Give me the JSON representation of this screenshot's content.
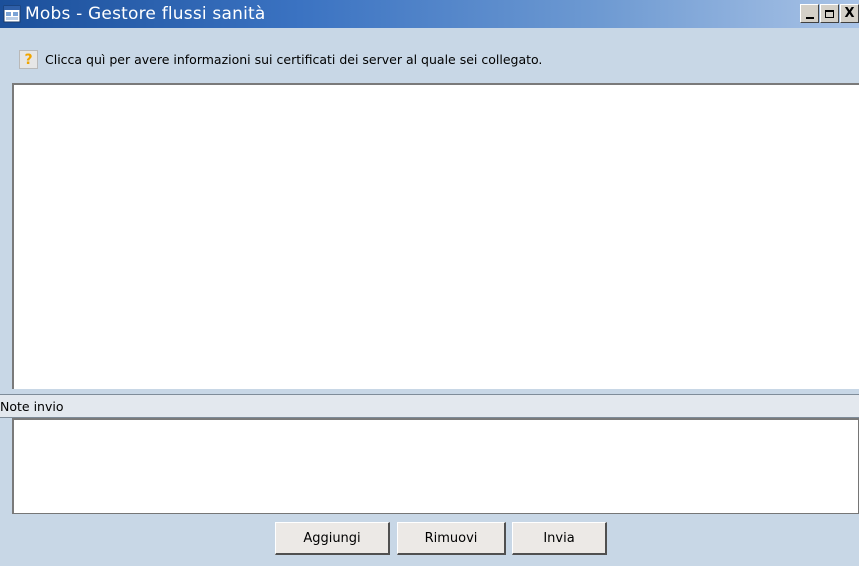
{
  "window": {
    "title": "Mobs - Gestore flussi sanità",
    "controls": {
      "minimize": "_",
      "maximize": "□",
      "close": "X"
    }
  },
  "info": {
    "icon": "?",
    "text": "Clicca quì per avere informazioni sui certificati dei server al quale sei collegato."
  },
  "notes": {
    "label": "Note invio",
    "value": ""
  },
  "footer": {
    "add_label": "Aggiungi",
    "remove_label": "Rimuovi",
    "send_label": "Invia"
  },
  "colors": {
    "titlebar_start": "#1b4f9a",
    "titlebar_end": "#a9c3e6",
    "window_bg": "#c8d7e6",
    "help_icon": "#f0a500"
  },
  "icons": [
    "app-window-icon",
    "help-icon",
    "minimize-icon",
    "maximize-icon",
    "close-icon"
  ]
}
